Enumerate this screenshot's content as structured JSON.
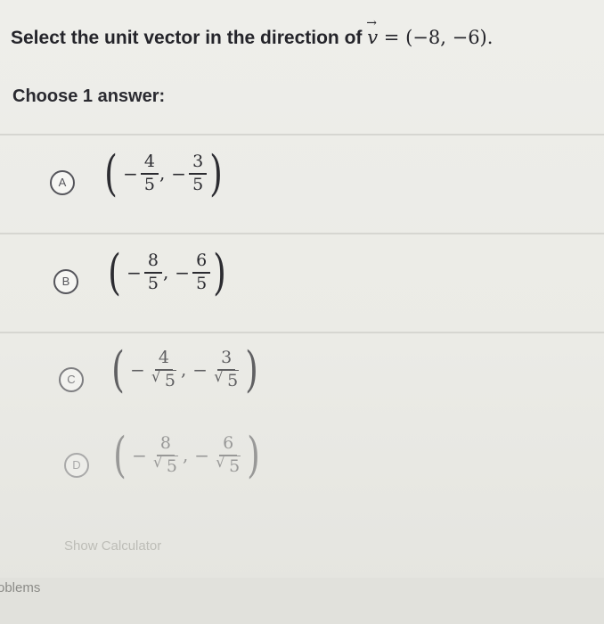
{
  "question": {
    "text": "Select the unit vector in the direction of",
    "vector_symbol": "v",
    "equals": "=",
    "value": "(−8, −6)."
  },
  "prompt": "Choose 1 answer:",
  "choices": [
    {
      "letter": "A",
      "x_num": "4",
      "x_den": "5",
      "y_num": "3",
      "y_den": "5",
      "sqrt_den": false
    },
    {
      "letter": "B",
      "x_num": "8",
      "x_den": "5",
      "y_num": "6",
      "y_den": "5",
      "sqrt_den": false
    },
    {
      "letter": "C",
      "x_num": "4",
      "x_den": "5",
      "y_num": "3",
      "y_den": "5",
      "sqrt_den": true
    },
    {
      "letter": "D",
      "x_num": "8",
      "x_den": "5",
      "y_num": "6",
      "y_den": "5",
      "sqrt_den": true
    }
  ],
  "show_calculator": "Show Calculator",
  "footer_text": "oblems",
  "colors": {
    "background": "#ebebe6",
    "text": "#26262b",
    "divider": "#d6d6d1"
  }
}
